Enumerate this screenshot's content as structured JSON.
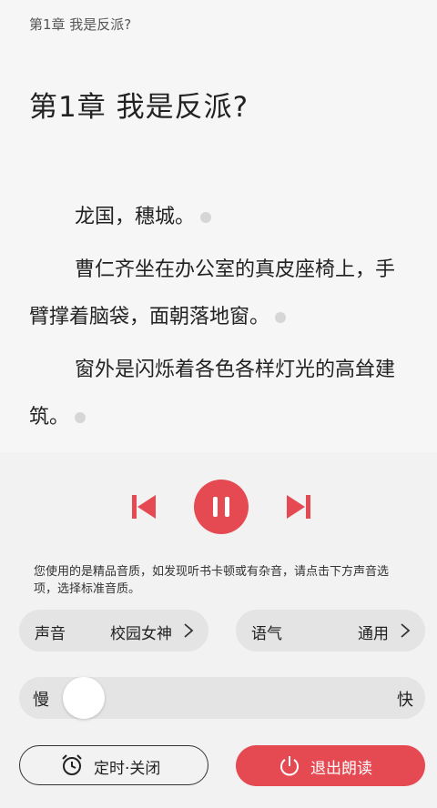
{
  "reader": {
    "running_head": "第1章 我是反派?",
    "chapter_title": "第1章 我是反派?",
    "paragraphs": [
      "龙国，穗城。",
      "曹仁齐坐在办公室的真皮座椅上，手臂撑着脑袋，面朝落地窗。",
      "窗外是闪烁着各色各样灯光的高耸建筑。"
    ]
  },
  "player": {
    "prev_icon": "skip-previous-icon",
    "play_pause_icon": "pause-icon",
    "next_icon": "skip-next-icon",
    "accent_color": "#e54a52",
    "notice": "您使用的是精品音质，如发现听书卡顿或有杂音，请点击下方声音选项，选择标准音质。",
    "voice": {
      "label": "声音",
      "value": "校园女神"
    },
    "tone": {
      "label": "语气",
      "value": "通用"
    },
    "speed": {
      "slow_label": "慢",
      "fast_label": "快",
      "level": 0.16
    },
    "timer": {
      "label": "定时·关闭",
      "icon": "alarm-clock-icon"
    },
    "exit": {
      "label": "退出朗读",
      "icon": "power-icon"
    }
  }
}
